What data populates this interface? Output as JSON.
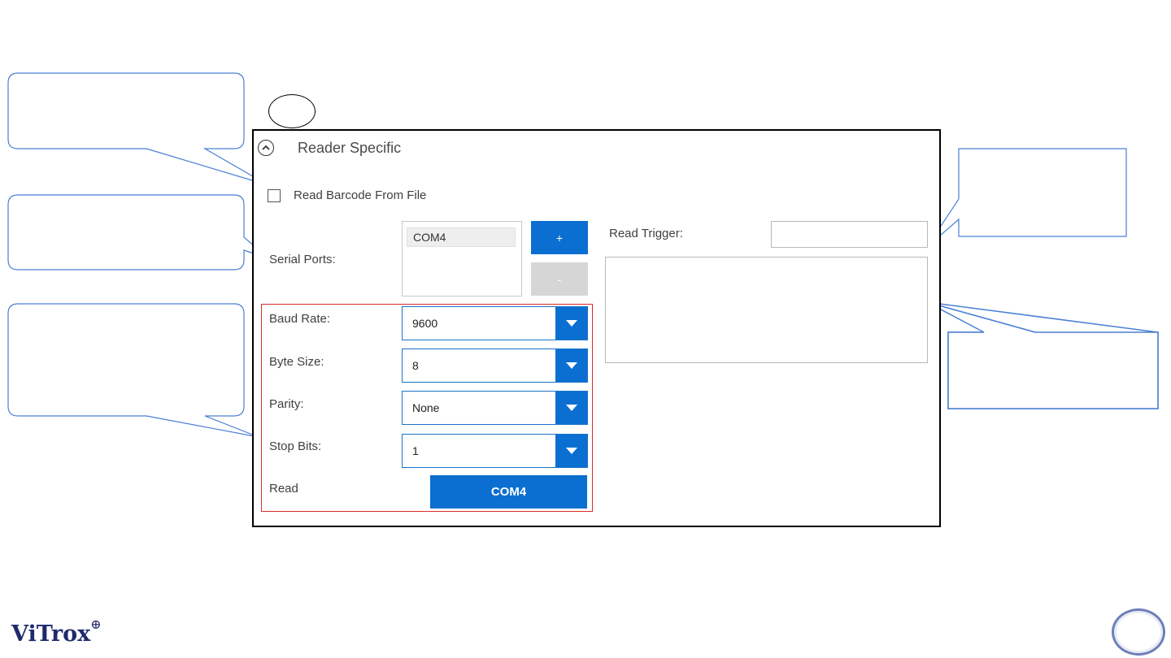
{
  "panel": {
    "section_title": "Reader Specific",
    "read_from_file_label": "Read Barcode From File",
    "serial_ports_label": "Serial Ports:",
    "serial_ports": [
      "COM4"
    ],
    "add_port_label": "+",
    "remove_port_label": "-",
    "baud_rate": {
      "label": "Baud Rate:",
      "value": "9600"
    },
    "byte_size": {
      "label": "Byte Size:",
      "value": "8"
    },
    "parity": {
      "label": "Parity:",
      "value": "None"
    },
    "stop_bits": {
      "label": "Stop Bits:",
      "value": "1"
    },
    "read_label": "Read",
    "read_button_label": "COM4",
    "read_trigger_label": "Read Trigger:",
    "read_trigger_value": ""
  },
  "footer": {
    "logo_text": "ViTrox",
    "logo_mark": "⊕"
  },
  "colors": {
    "accent_blue": "#0a6fd0",
    "disabled_gray": "#d6d6d6",
    "highlight_red": "#d92b2b",
    "callout_blue": "#4a7fd4"
  }
}
